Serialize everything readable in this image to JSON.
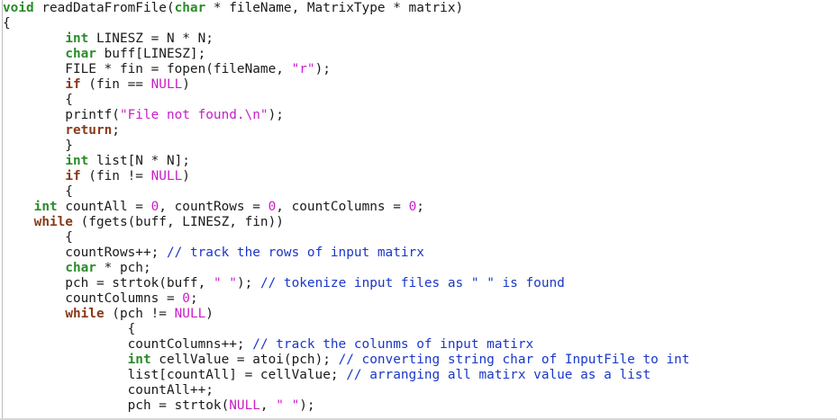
{
  "editor": {
    "lines": [
      [
        [
          "type",
          "void"
        ],
        [
          "plain",
          " readDataFromFile("
        ],
        [
          "type",
          "char"
        ],
        [
          "plain",
          " * fileName, MatrixType * matrix)"
        ]
      ],
      [
        [
          "plain",
          "{"
        ]
      ],
      [
        [
          "plain",
          "        "
        ],
        [
          "type",
          "int"
        ],
        [
          "plain",
          " LINESZ = N * N;"
        ]
      ],
      [
        [
          "plain",
          "        "
        ],
        [
          "type",
          "char"
        ],
        [
          "plain",
          " buff[LINESZ];"
        ]
      ],
      [
        [
          "plain",
          "        FILE * fin = fopen(fileName, "
        ],
        [
          "string",
          "\"r\""
        ],
        [
          "plain",
          ");"
        ]
      ],
      [
        [
          "plain",
          "        "
        ],
        [
          "keyword",
          "if"
        ],
        [
          "plain",
          " (fin == "
        ],
        [
          "constant",
          "NULL"
        ],
        [
          "plain",
          ")"
        ]
      ],
      [
        [
          "plain",
          "        {"
        ]
      ],
      [
        [
          "plain",
          "        printf("
        ],
        [
          "string",
          "\"File not found.\\n\""
        ],
        [
          "plain",
          ");"
        ]
      ],
      [
        [
          "plain",
          "        "
        ],
        [
          "keyword",
          "return"
        ],
        [
          "plain",
          ";"
        ]
      ],
      [
        [
          "plain",
          "        }"
        ]
      ],
      [
        [
          "plain",
          "        "
        ],
        [
          "type",
          "int"
        ],
        [
          "plain",
          " list[N * N];"
        ]
      ],
      [
        [
          "plain",
          "        "
        ],
        [
          "keyword",
          "if"
        ],
        [
          "plain",
          " (fin != "
        ],
        [
          "constant",
          "NULL"
        ],
        [
          "plain",
          ")"
        ]
      ],
      [
        [
          "plain",
          "        {"
        ]
      ],
      [
        [
          "plain",
          "    "
        ],
        [
          "type",
          "int"
        ],
        [
          "plain",
          " countAll = "
        ],
        [
          "number",
          "0"
        ],
        [
          "plain",
          ", countRows = "
        ],
        [
          "number",
          "0"
        ],
        [
          "plain",
          ", countColumns = "
        ],
        [
          "number",
          "0"
        ],
        [
          "plain",
          ";"
        ]
      ],
      [
        [
          "plain",
          "    "
        ],
        [
          "keyword",
          "while"
        ],
        [
          "plain",
          " (fgets(buff, LINESZ, fin))"
        ]
      ],
      [
        [
          "plain",
          "        {"
        ]
      ],
      [
        [
          "plain",
          "        countRows++; "
        ],
        [
          "comment",
          "// track the rows of input matirx"
        ]
      ],
      [
        [
          "plain",
          "        "
        ],
        [
          "type",
          "char"
        ],
        [
          "plain",
          " * pch;"
        ]
      ],
      [
        [
          "plain",
          "        pch = strtok(buff, "
        ],
        [
          "string",
          "\" \""
        ],
        [
          "plain",
          "); "
        ],
        [
          "comment",
          "// tokenize input files as \" \" is found"
        ]
      ],
      [
        [
          "plain",
          "        countColumns = "
        ],
        [
          "number",
          "0"
        ],
        [
          "plain",
          ";"
        ]
      ],
      [
        [
          "plain",
          "        "
        ],
        [
          "keyword",
          "while"
        ],
        [
          "plain",
          " (pch != "
        ],
        [
          "constant",
          "NULL"
        ],
        [
          "plain",
          ")"
        ]
      ],
      [
        [
          "plain",
          "                {"
        ]
      ],
      [
        [
          "plain",
          "                countColumns++; "
        ],
        [
          "comment",
          "// track the colunms of input matirx"
        ]
      ],
      [
        [
          "plain",
          "                "
        ],
        [
          "type",
          "int"
        ],
        [
          "plain",
          " cellValue = atoi(pch); "
        ],
        [
          "comment",
          "// converting string char of InputFile to int"
        ]
      ],
      [
        [
          "plain",
          "                list[countAll] = cellValue; "
        ],
        [
          "comment",
          "// arranging all matirx value as a list"
        ]
      ],
      [
        [
          "plain",
          "                countAll++;"
        ]
      ],
      [
        [
          "plain",
          "                pch = strtok("
        ],
        [
          "constant",
          "NULL"
        ],
        [
          "plain",
          ", "
        ],
        [
          "string",
          "\" \""
        ],
        [
          "plain",
          ");"
        ]
      ]
    ]
  },
  "colors": {
    "type": "#2a8c2a",
    "keyword": "#8a3a1a",
    "string": "#c81ec8",
    "number": "#c81ec8",
    "constant": "#c81ec8",
    "comment": "#1a37c8",
    "plain": "#1a1a1a",
    "background": "#ffffff"
  }
}
